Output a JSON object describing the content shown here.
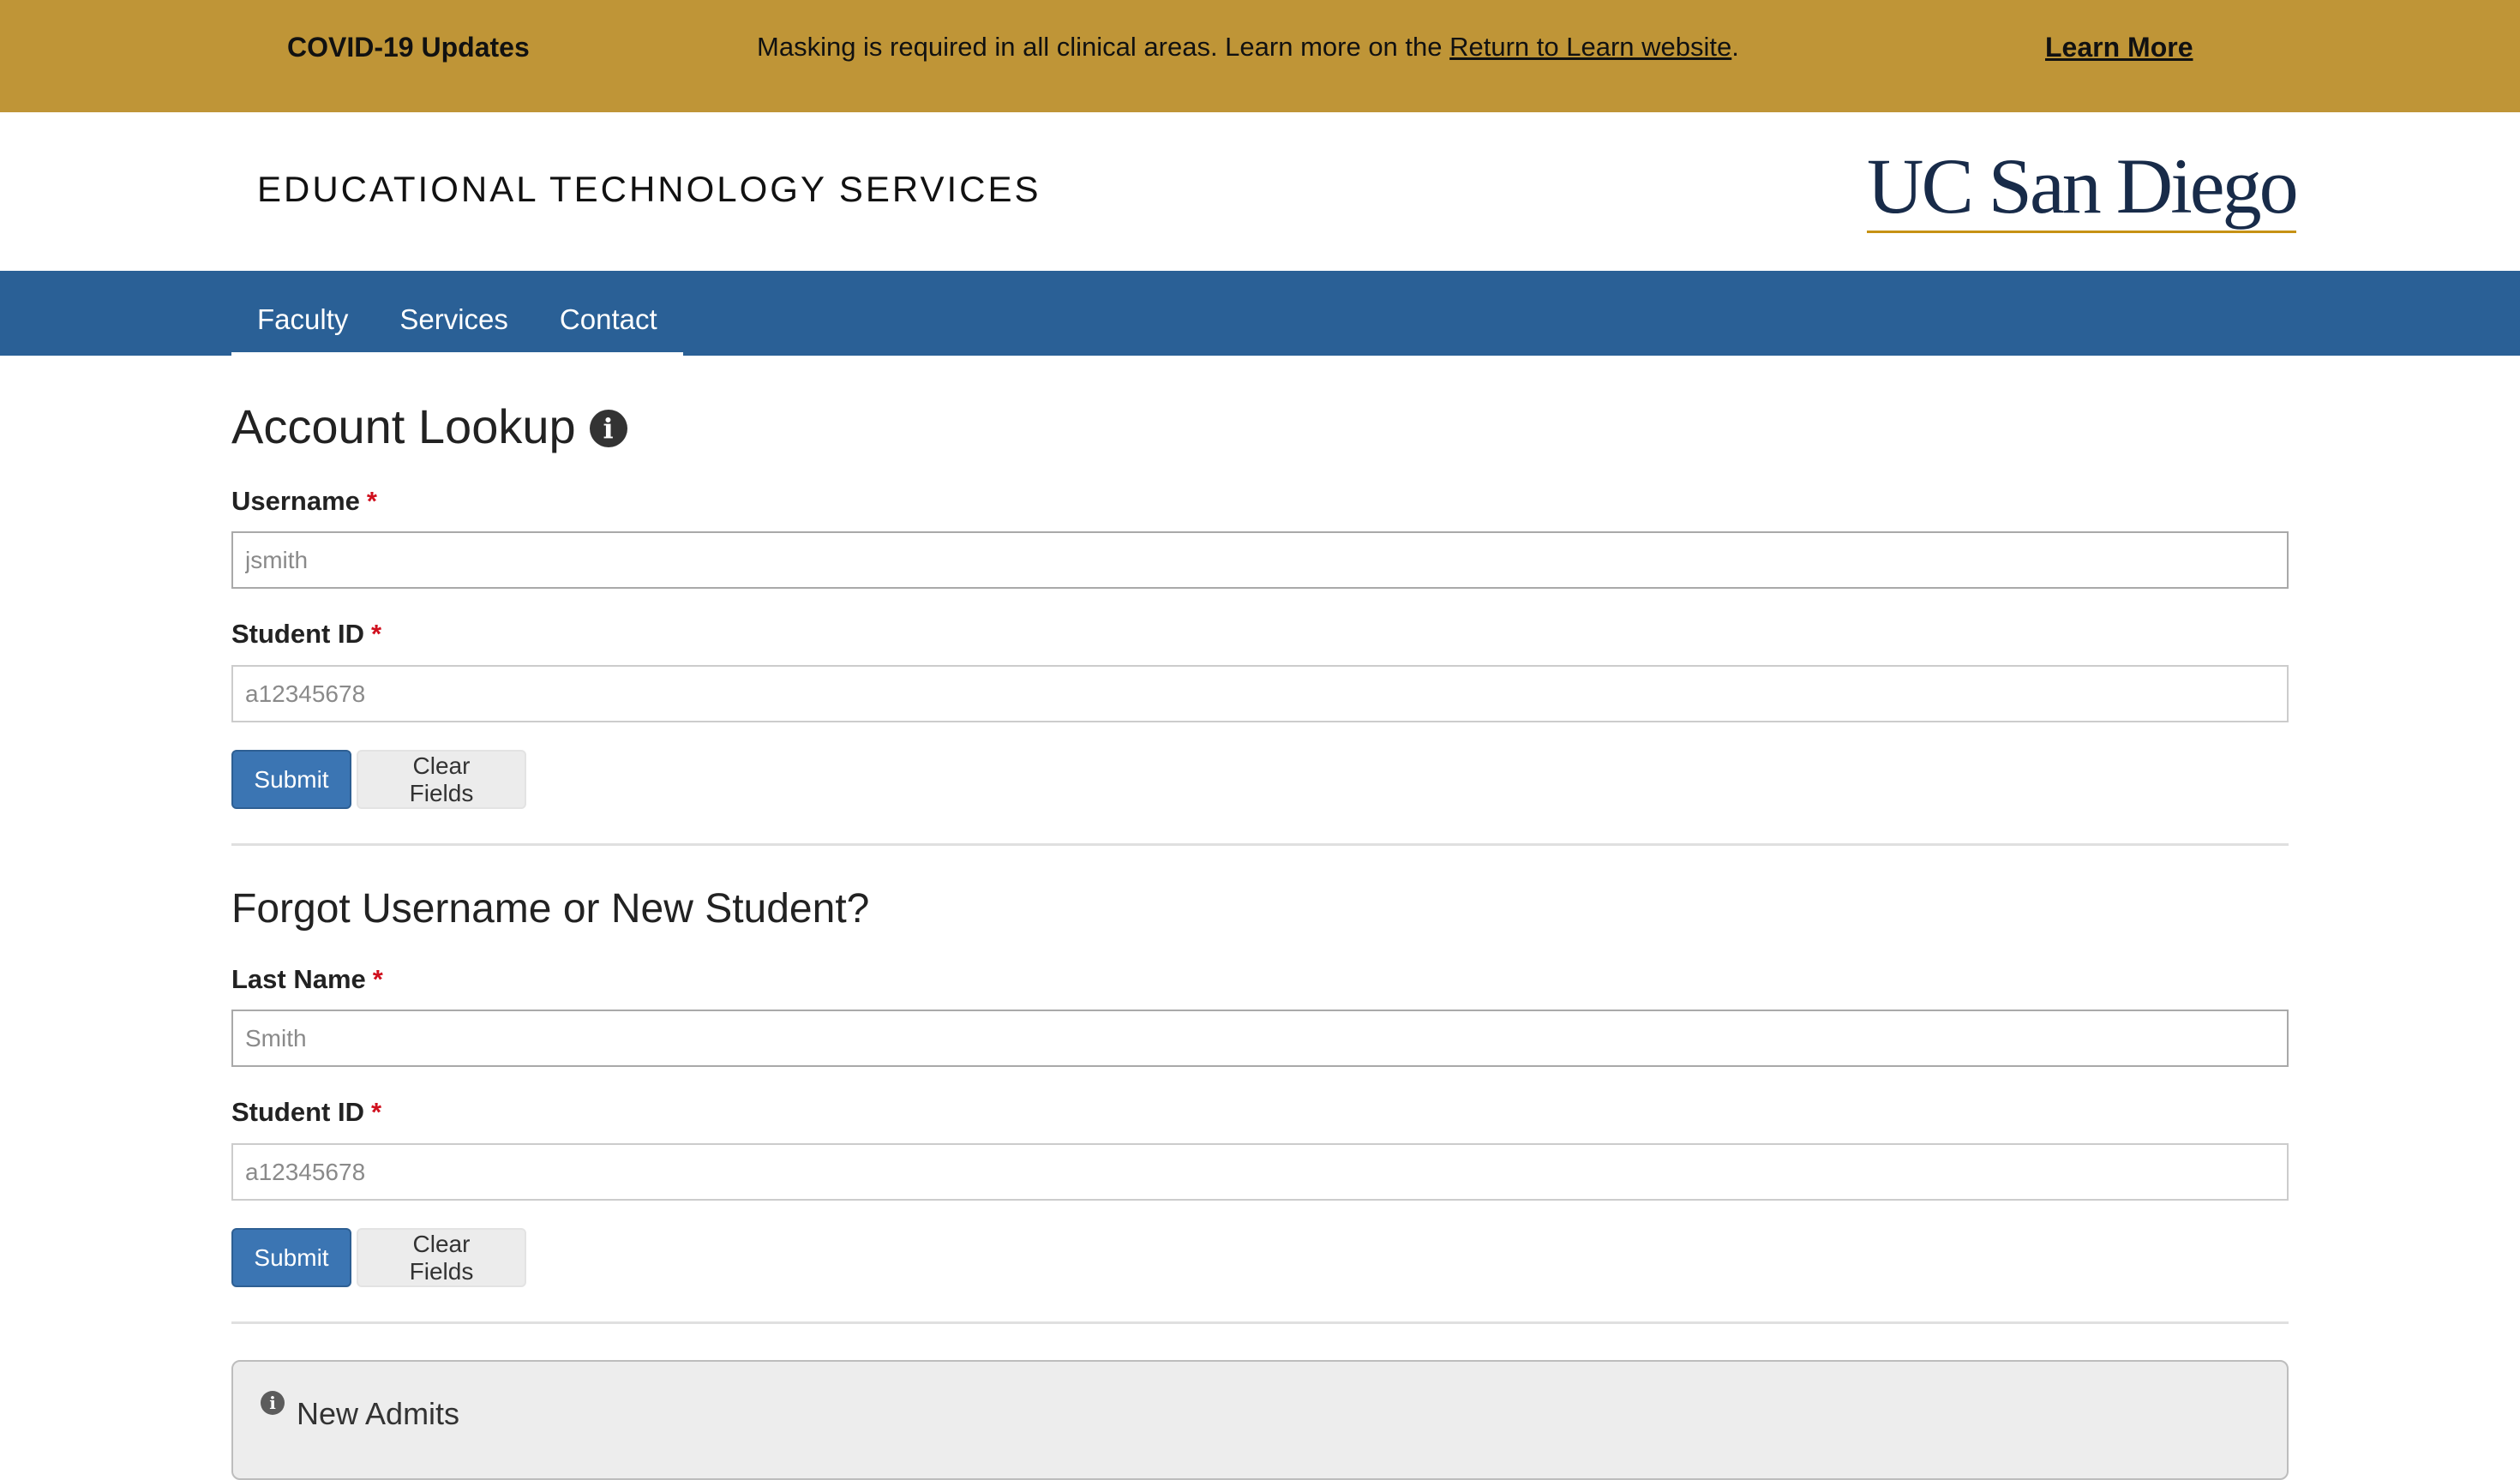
{
  "banner": {
    "title": "COVID-19 Updates",
    "message_prefix": "Masking is required in all clinical areas. Learn more on the ",
    "message_link": "Return to Learn website",
    "message_suffix": ".",
    "learn_more": "Learn More",
    "bg_color": "#bf9537"
  },
  "header": {
    "site_title": "EDUCATIONAL TECHNOLOGY SERVICES",
    "logo_text": "UC San Diego"
  },
  "nav": {
    "items": [
      {
        "label": "Faculty"
      },
      {
        "label": "Services"
      },
      {
        "label": "Contact"
      }
    ],
    "bg_color": "#2a6096"
  },
  "account_lookup": {
    "title": "Account Lookup",
    "info_icon": "info-circle-icon",
    "username_label": "Username",
    "username_placeholder": "jsmith",
    "student_id_label": "Student ID",
    "student_id_placeholder": "a12345678",
    "submit_label": "Submit",
    "clear_label": "Clear Fields",
    "required_marker": "*"
  },
  "forgot": {
    "title": "Forgot Username or New Student?",
    "last_name_label": "Last Name",
    "last_name_placeholder": "Smith",
    "student_id_label": "Student ID",
    "student_id_placeholder": "a12345678",
    "submit_label": "Submit",
    "clear_label": "Clear Fields",
    "required_marker": "*"
  },
  "new_admits": {
    "title": "New Admits",
    "icon": "info-circle-icon"
  }
}
